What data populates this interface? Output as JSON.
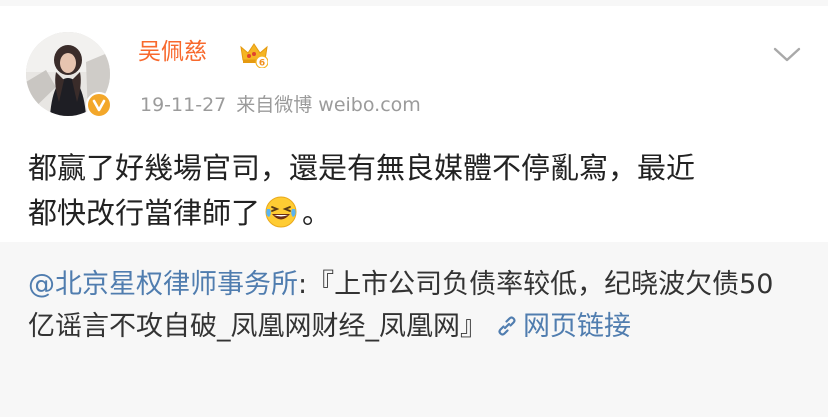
{
  "post": {
    "username": "吴佩慈",
    "vip_icon": "crown-vip-level-6-icon",
    "verified_icon": "verified-v-icon",
    "timestamp": "19-11-27",
    "source": "来自微博 weibo.com",
    "body_line_1": "都赢了好幾場官司，還是有無良媒體不停亂寫，最近",
    "body_line_2_before_emoji": "都快改行當律師了",
    "emoji": "laughing-tears-emoji",
    "body_line_2_after_emoji": "。",
    "more_icon": "chevron-down-icon"
  },
  "repost": {
    "mention": "@北京星权律师事务所",
    "text": ":『上市公司负债率较低，纪晓波欠债50亿谣言不攻自破_凤凰网财经_凤凰网』",
    "link_icon": "link-icon",
    "link_label": "网页链接"
  },
  "colors": {
    "username": "#f8692d",
    "meta": "#9b9b9b",
    "link": "#507daf",
    "repost_bg": "#f7f7f7"
  }
}
